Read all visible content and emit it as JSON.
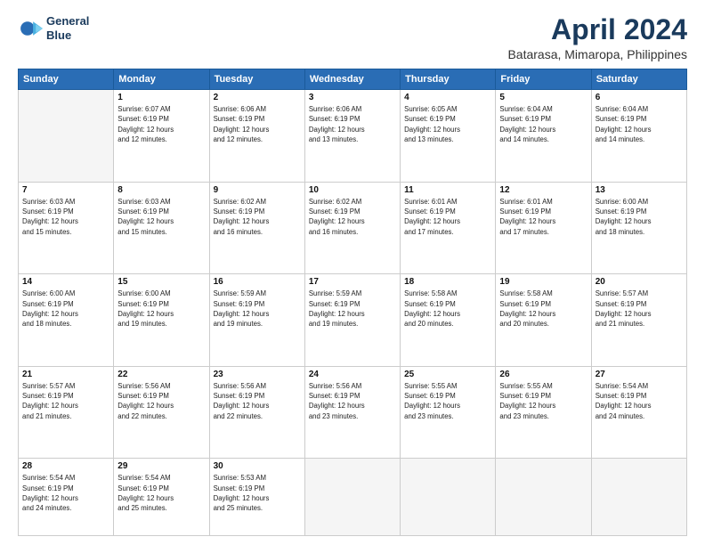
{
  "logo": {
    "line1": "General",
    "line2": "Blue"
  },
  "title": "April 2024",
  "subtitle": "Batarasa, Mimaropa, Philippines",
  "days_header": [
    "Sunday",
    "Monday",
    "Tuesday",
    "Wednesday",
    "Thursday",
    "Friday",
    "Saturday"
  ],
  "weeks": [
    [
      {
        "day": "",
        "info": ""
      },
      {
        "day": "1",
        "info": "Sunrise: 6:07 AM\nSunset: 6:19 PM\nDaylight: 12 hours\nand 12 minutes."
      },
      {
        "day": "2",
        "info": "Sunrise: 6:06 AM\nSunset: 6:19 PM\nDaylight: 12 hours\nand 12 minutes."
      },
      {
        "day": "3",
        "info": "Sunrise: 6:06 AM\nSunset: 6:19 PM\nDaylight: 12 hours\nand 13 minutes."
      },
      {
        "day": "4",
        "info": "Sunrise: 6:05 AM\nSunset: 6:19 PM\nDaylight: 12 hours\nand 13 minutes."
      },
      {
        "day": "5",
        "info": "Sunrise: 6:04 AM\nSunset: 6:19 PM\nDaylight: 12 hours\nand 14 minutes."
      },
      {
        "day": "6",
        "info": "Sunrise: 6:04 AM\nSunset: 6:19 PM\nDaylight: 12 hours\nand 14 minutes."
      }
    ],
    [
      {
        "day": "7",
        "info": "Sunrise: 6:03 AM\nSunset: 6:19 PM\nDaylight: 12 hours\nand 15 minutes."
      },
      {
        "day": "8",
        "info": "Sunrise: 6:03 AM\nSunset: 6:19 PM\nDaylight: 12 hours\nand 15 minutes."
      },
      {
        "day": "9",
        "info": "Sunrise: 6:02 AM\nSunset: 6:19 PM\nDaylight: 12 hours\nand 16 minutes."
      },
      {
        "day": "10",
        "info": "Sunrise: 6:02 AM\nSunset: 6:19 PM\nDaylight: 12 hours\nand 16 minutes."
      },
      {
        "day": "11",
        "info": "Sunrise: 6:01 AM\nSunset: 6:19 PM\nDaylight: 12 hours\nand 17 minutes."
      },
      {
        "day": "12",
        "info": "Sunrise: 6:01 AM\nSunset: 6:19 PM\nDaylight: 12 hours\nand 17 minutes."
      },
      {
        "day": "13",
        "info": "Sunrise: 6:00 AM\nSunset: 6:19 PM\nDaylight: 12 hours\nand 18 minutes."
      }
    ],
    [
      {
        "day": "14",
        "info": "Sunrise: 6:00 AM\nSunset: 6:19 PM\nDaylight: 12 hours\nand 18 minutes."
      },
      {
        "day": "15",
        "info": "Sunrise: 6:00 AM\nSunset: 6:19 PM\nDaylight: 12 hours\nand 19 minutes."
      },
      {
        "day": "16",
        "info": "Sunrise: 5:59 AM\nSunset: 6:19 PM\nDaylight: 12 hours\nand 19 minutes."
      },
      {
        "day": "17",
        "info": "Sunrise: 5:59 AM\nSunset: 6:19 PM\nDaylight: 12 hours\nand 19 minutes."
      },
      {
        "day": "18",
        "info": "Sunrise: 5:58 AM\nSunset: 6:19 PM\nDaylight: 12 hours\nand 20 minutes."
      },
      {
        "day": "19",
        "info": "Sunrise: 5:58 AM\nSunset: 6:19 PM\nDaylight: 12 hours\nand 20 minutes."
      },
      {
        "day": "20",
        "info": "Sunrise: 5:57 AM\nSunset: 6:19 PM\nDaylight: 12 hours\nand 21 minutes."
      }
    ],
    [
      {
        "day": "21",
        "info": "Sunrise: 5:57 AM\nSunset: 6:19 PM\nDaylight: 12 hours\nand 21 minutes."
      },
      {
        "day": "22",
        "info": "Sunrise: 5:56 AM\nSunset: 6:19 PM\nDaylight: 12 hours\nand 22 minutes."
      },
      {
        "day": "23",
        "info": "Sunrise: 5:56 AM\nSunset: 6:19 PM\nDaylight: 12 hours\nand 22 minutes."
      },
      {
        "day": "24",
        "info": "Sunrise: 5:56 AM\nSunset: 6:19 PM\nDaylight: 12 hours\nand 23 minutes."
      },
      {
        "day": "25",
        "info": "Sunrise: 5:55 AM\nSunset: 6:19 PM\nDaylight: 12 hours\nand 23 minutes."
      },
      {
        "day": "26",
        "info": "Sunrise: 5:55 AM\nSunset: 6:19 PM\nDaylight: 12 hours\nand 23 minutes."
      },
      {
        "day": "27",
        "info": "Sunrise: 5:54 AM\nSunset: 6:19 PM\nDaylight: 12 hours\nand 24 minutes."
      }
    ],
    [
      {
        "day": "28",
        "info": "Sunrise: 5:54 AM\nSunset: 6:19 PM\nDaylight: 12 hours\nand 24 minutes."
      },
      {
        "day": "29",
        "info": "Sunrise: 5:54 AM\nSunset: 6:19 PM\nDaylight: 12 hours\nand 25 minutes."
      },
      {
        "day": "30",
        "info": "Sunrise: 5:53 AM\nSunset: 6:19 PM\nDaylight: 12 hours\nand 25 minutes."
      },
      {
        "day": "",
        "info": ""
      },
      {
        "day": "",
        "info": ""
      },
      {
        "day": "",
        "info": ""
      },
      {
        "day": "",
        "info": ""
      }
    ]
  ]
}
